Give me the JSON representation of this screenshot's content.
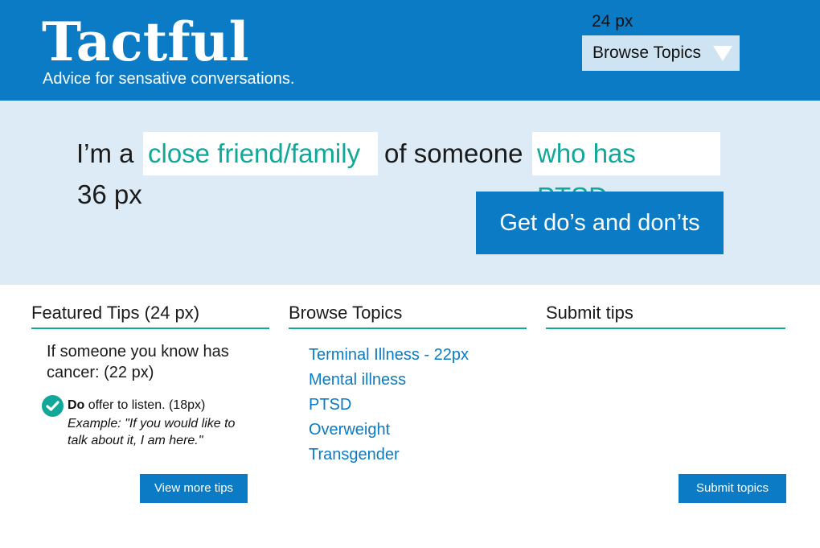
{
  "header": {
    "title": "Tactful",
    "tagline": "Advice for sensative conversations.",
    "size_note": "24 px",
    "browse_label": "Browse Topics"
  },
  "hero": {
    "prefix": "I’m a",
    "relationship": "close friend/family",
    "middle": "of someone",
    "condition": "who has PTSD.",
    "size_note": "36 px",
    "cta": "Get do’s and don’ts"
  },
  "featured": {
    "heading": "Featured Tips (24 px)",
    "intro": "If someone you know has cancer: (22 px)",
    "tip_do": "Do",
    "tip_text": " offer to listen. (18px)",
    "example": "Example: \"If you would like to talk about it, I am here.\"",
    "button": "View more tips"
  },
  "browse": {
    "heading": "Browse Topics",
    "topics": [
      "Terminal Illness - 22px",
      "Mental illness",
      "PTSD",
      "Overweight",
      "Transgender"
    ]
  },
  "submit": {
    "heading": "Submit tips",
    "button": "Submit topics"
  },
  "colors": {
    "brand_blue": "#0a7bc4",
    "teal": "#11a89a",
    "hero_bg": "#dcebf6",
    "dropdown_bg": "#cfe4f3"
  }
}
